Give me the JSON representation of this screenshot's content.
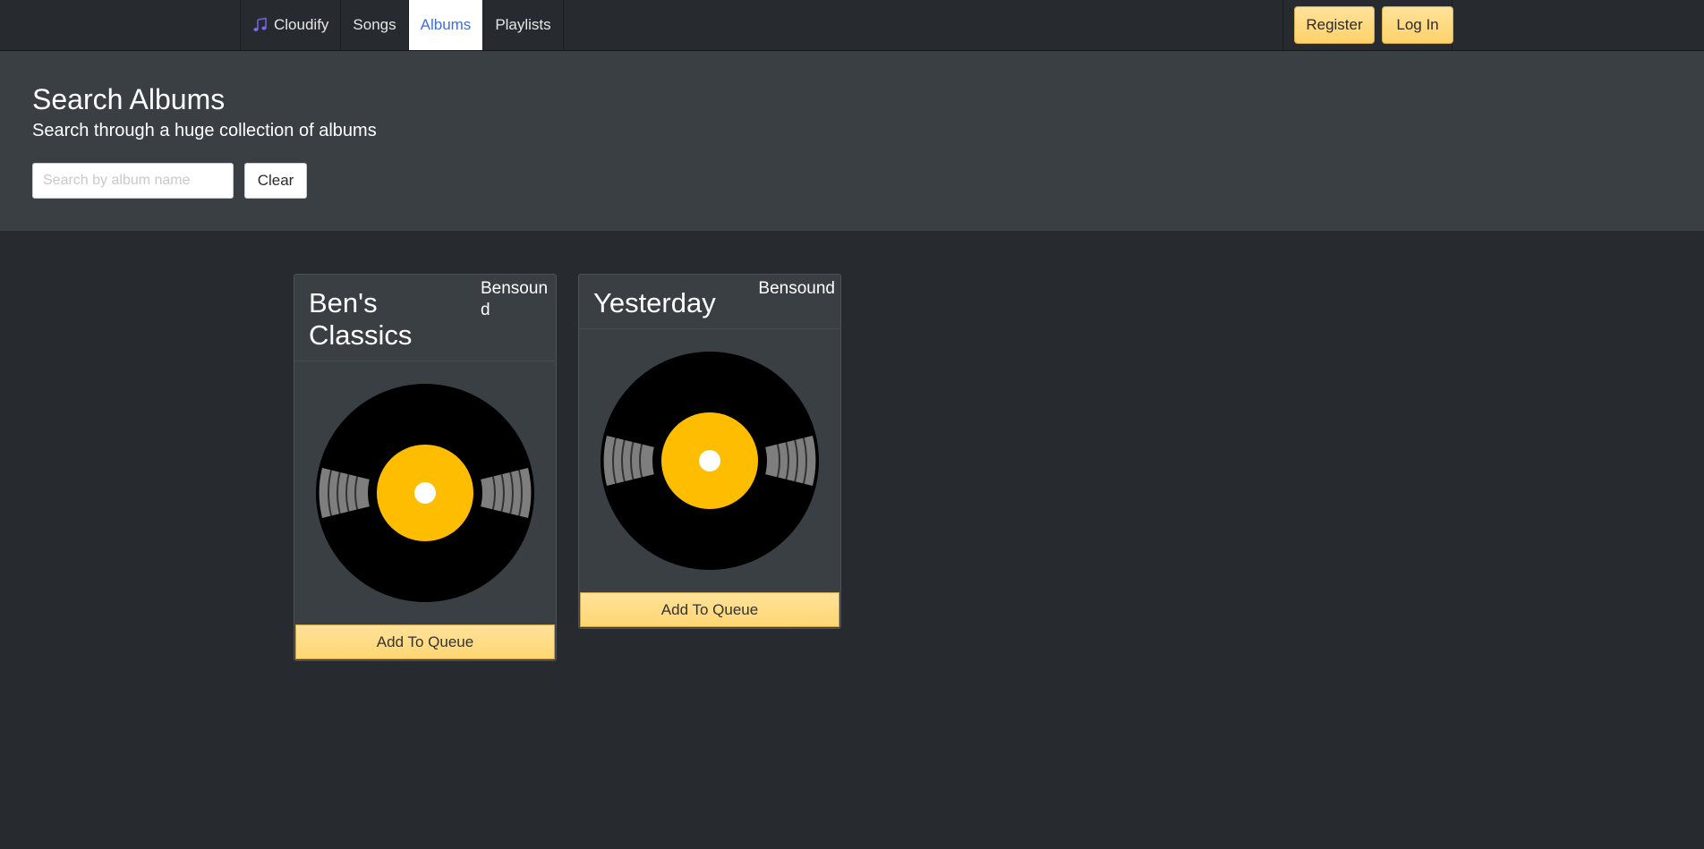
{
  "nav": {
    "brand_label": "Cloudify",
    "brand_icon": "music-notes-icon",
    "tabs": [
      {
        "label": "Songs",
        "active": false
      },
      {
        "label": "Albums",
        "active": true
      },
      {
        "label": "Playlists",
        "active": false
      }
    ],
    "register_label": "Register",
    "login_label": "Log In"
  },
  "hero": {
    "title": "Search Albums",
    "subtitle": "Search through a huge collection of albums",
    "search_placeholder": "Search by album name",
    "search_value": "",
    "clear_label": "Clear"
  },
  "albums": [
    {
      "title": "Ben's Classics",
      "artist": "Bensound",
      "cover_icon": "vinyl-record-icon",
      "action_label": "Add To Queue"
    },
    {
      "title": "Yesterday",
      "artist": "Bensound",
      "cover_icon": "vinyl-record-icon",
      "action_label": "Add To Queue"
    }
  ],
  "colors": {
    "page_background": "#272b30",
    "hero_background": "#3a3f44",
    "accent_warning": "#ffd26a",
    "active_tab_text": "#3f6fd6",
    "record_label": "#ffbd00"
  }
}
